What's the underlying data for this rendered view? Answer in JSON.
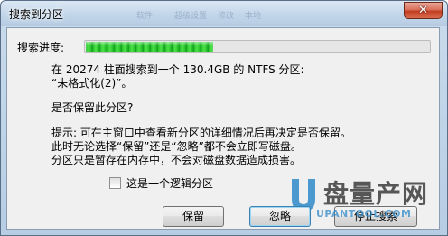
{
  "window": {
    "title": "搜索到分区",
    "close_glyph": "✕",
    "background_ghost": [
      "软件",
      "超级设置",
      "修改",
      "本地"
    ]
  },
  "progress": {
    "label": "搜索进度:",
    "fraction": 0.37,
    "color": "#22c22a"
  },
  "message": {
    "found": "在 20274 柱面搜索到一个 130.4GB 的 NTFS 分区:\n“未格式化(2)”。",
    "question": "是否保留此分区?",
    "hint": "提示: 可在主窗口中查看新分区的详细情况后再决定是否保留。\n此时无论选择“保留”还是“忽略”都不会立即写磁盘。\n分区只是暂存在内存中，不会对磁盘数据造成损害。"
  },
  "logical_checkbox": {
    "label": "这是一个逻辑分区",
    "checked": false
  },
  "buttons": {
    "keep": "保留",
    "ignore": "忽略",
    "stop": "停止搜索"
  },
  "watermark": {
    "brand": "盘量产网",
    "url": "UPANTOOL.COM",
    "color": "#2f8ac9"
  }
}
